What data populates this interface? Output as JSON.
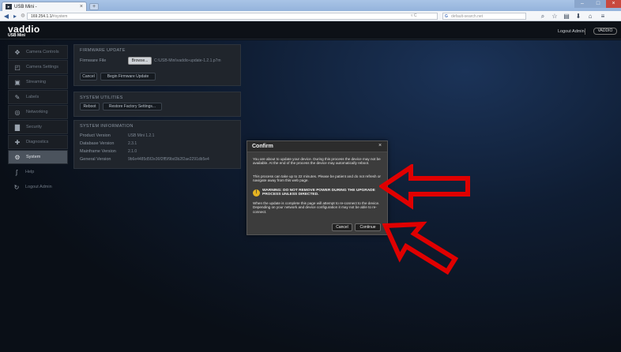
{
  "browser": {
    "tab_title": "USB Mini -",
    "tab_close": "×",
    "new_tab": "+",
    "url": "169.254.1.1/",
    "url_tail": "#system",
    "url_extras": "▿ C",
    "search_placeholder": "default-search.net",
    "win_min": "–",
    "win_max": "□",
    "win_close": "×"
  },
  "header": {
    "logo": "vaddio",
    "product": "USB Mini",
    "logout_label": "Logout Admin",
    "vaddio_button": "VADDIO"
  },
  "sidebar": {
    "items": [
      {
        "label": "Camera Controls",
        "icon": "joystick-icon"
      },
      {
        "label": "Camera Settings",
        "icon": "camera-settings-icon"
      },
      {
        "label": "Streaming",
        "icon": "streaming-icon"
      },
      {
        "label": "Labels",
        "icon": "pencil-icon"
      },
      {
        "label": "Networking",
        "icon": "network-icon"
      },
      {
        "label": "Security",
        "icon": "lock-icon"
      },
      {
        "label": "Diagnostics",
        "icon": "diagnostics-icon"
      },
      {
        "label": "System",
        "icon": "gear-icon",
        "active": true
      },
      {
        "label": "Help",
        "icon": "help-icon"
      },
      {
        "label": "Logout Admin",
        "icon": "logout-icon"
      }
    ]
  },
  "firmware": {
    "title": "FIRMWARE UPDATE",
    "file_label": "Firmware File",
    "browse_label": "Browse...",
    "file_name": "C:\\USB-Mini\\vaddio-update-1.2.1.p7m",
    "cancel_label": "Cancel",
    "begin_label": "Begin Firmware Update"
  },
  "utilities": {
    "title": "SYSTEM UTILITIES",
    "reboot_label": "Reboot",
    "restore_label": "Restore Factory Settings..."
  },
  "system_info": {
    "title": "SYSTEM INFORMATION",
    "rows": [
      {
        "label": "Product Version",
        "value": "USB Mini 1.2.1"
      },
      {
        "label": "Database Version",
        "value": "2.3.1"
      },
      {
        "label": "Mainframe Version",
        "value": "2.1.0"
      },
      {
        "label": "General Version",
        "value": "9b6e4485d5f2e36f2ff5f9bd3b2f2ae2291db5e4"
      }
    ]
  },
  "modal": {
    "title": "Confirm",
    "close": "×",
    "para1": "You are about to update your device. During this process the device may not be available. At the end of the process the device may automatically reboot.",
    "para2": "This process can take up to 22 minutes. Please be patient and do not refresh or navigate away from this web page.",
    "warning": "WARNING: DO NOT REMOVE POWER DURING THE UPGRADE PROCESS UNLESS DIRECTED.",
    "para3": "When the update is complete this page will attempt to re-connect to the device. Depending on your network and device configuration it may not be able to re-connect.",
    "cancel_label": "Cancel",
    "continue_label": "Continue"
  },
  "colors": {
    "accent": "#e00000",
    "warning": "#e6b422"
  }
}
